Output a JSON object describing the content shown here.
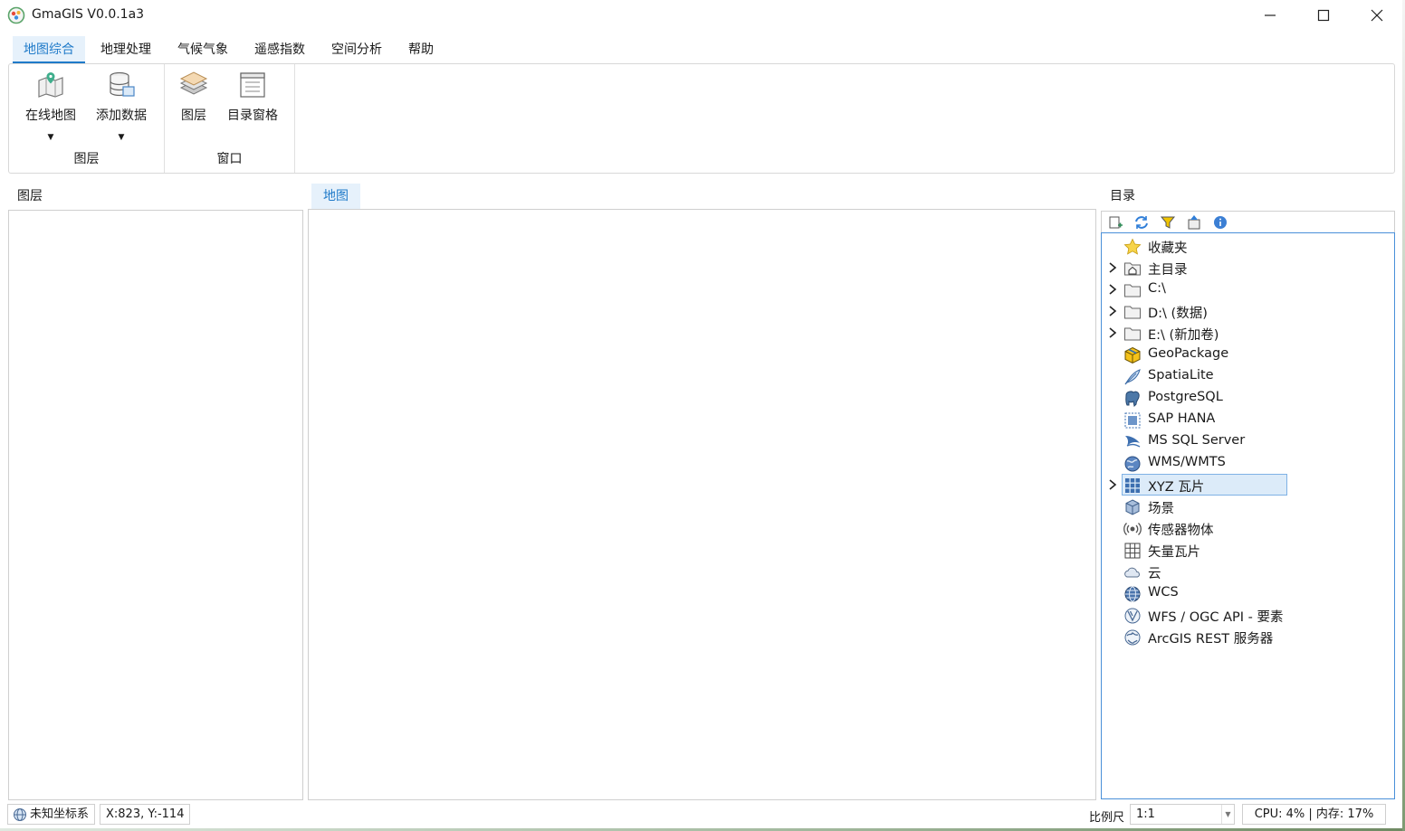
{
  "app": {
    "title": "GmaGIS V0.0.1a3",
    "window_controls": [
      "minimize",
      "maximize",
      "close"
    ]
  },
  "ribbon": {
    "tabs": [
      {
        "label": "地图综合",
        "active": true
      },
      {
        "label": "地理处理"
      },
      {
        "label": "气候气象"
      },
      {
        "label": "遥感指数"
      },
      {
        "label": "空间分析"
      },
      {
        "label": "帮助"
      }
    ],
    "groups": [
      {
        "label": "图层",
        "buttons": [
          {
            "label": "在线地图",
            "icon": "online-map-icon",
            "dropdown": true
          },
          {
            "label": "添加数据",
            "icon": "add-data-icon",
            "dropdown": true
          }
        ]
      },
      {
        "label": "窗口",
        "buttons": [
          {
            "label": "图层",
            "icon": "layers-icon"
          },
          {
            "label": "目录窗格",
            "icon": "catalog-pane-icon"
          }
        ]
      }
    ]
  },
  "panes": {
    "layers_title": "图层",
    "map_tab": "地图",
    "catalog_title": "目录"
  },
  "catalog": {
    "toolbar": [
      "new-icon",
      "refresh-icon",
      "filter-icon",
      "collapse-icon",
      "info-icon"
    ],
    "items": [
      {
        "label": "收藏夹",
        "icon": "star-icon",
        "expandable": false
      },
      {
        "label": "主目录",
        "icon": "home-folder-icon",
        "expandable": true
      },
      {
        "label": "C:\\",
        "icon": "folder-icon",
        "expandable": true
      },
      {
        "label": "D:\\ (数据)",
        "icon": "folder-icon",
        "expandable": true
      },
      {
        "label": "E:\\ (新加卷)",
        "icon": "folder-icon",
        "expandable": true
      },
      {
        "label": "GeoPackage",
        "icon": "geopackage-icon",
        "expandable": false
      },
      {
        "label": "SpatiaLite",
        "icon": "feather-icon",
        "expandable": false
      },
      {
        "label": "PostgreSQL",
        "icon": "elephant-icon",
        "expandable": false
      },
      {
        "label": "SAP HANA",
        "icon": "hana-icon",
        "expandable": false
      },
      {
        "label": "MS SQL Server",
        "icon": "mssql-icon",
        "expandable": false
      },
      {
        "label": "WMS/WMTS",
        "icon": "globe-icon",
        "expandable": false
      },
      {
        "label": "XYZ 瓦片",
        "icon": "tiles-icon",
        "expandable": true,
        "selected": true
      },
      {
        "label": "场景",
        "icon": "cube-icon",
        "expandable": false
      },
      {
        "label": "传感器物体",
        "icon": "sensor-icon",
        "expandable": false
      },
      {
        "label": "矢量瓦片",
        "icon": "vector-tiles-icon",
        "expandable": false
      },
      {
        "label": "云",
        "icon": "cloud-icon",
        "expandable": false
      },
      {
        "label": "WCS",
        "icon": "wcs-globe-icon",
        "expandable": false
      },
      {
        "label": "WFS / OGC API - 要素",
        "icon": "wfs-globe-icon",
        "expandable": false
      },
      {
        "label": "ArcGIS REST 服务器",
        "icon": "arcgis-globe-icon",
        "expandable": false
      }
    ]
  },
  "status": {
    "crs": "未知坐标系",
    "coords": "X:823, Y:-114",
    "scale_label": "比例尺",
    "scale_value": "1:1",
    "resources": "CPU:  4% | 内存: 17%"
  },
  "colors": {
    "accent": "#1f7ac9",
    "accent_bg": "#e6f1fb",
    "selection_bg": "#dcebf9",
    "border": "#cfcfcf"
  }
}
